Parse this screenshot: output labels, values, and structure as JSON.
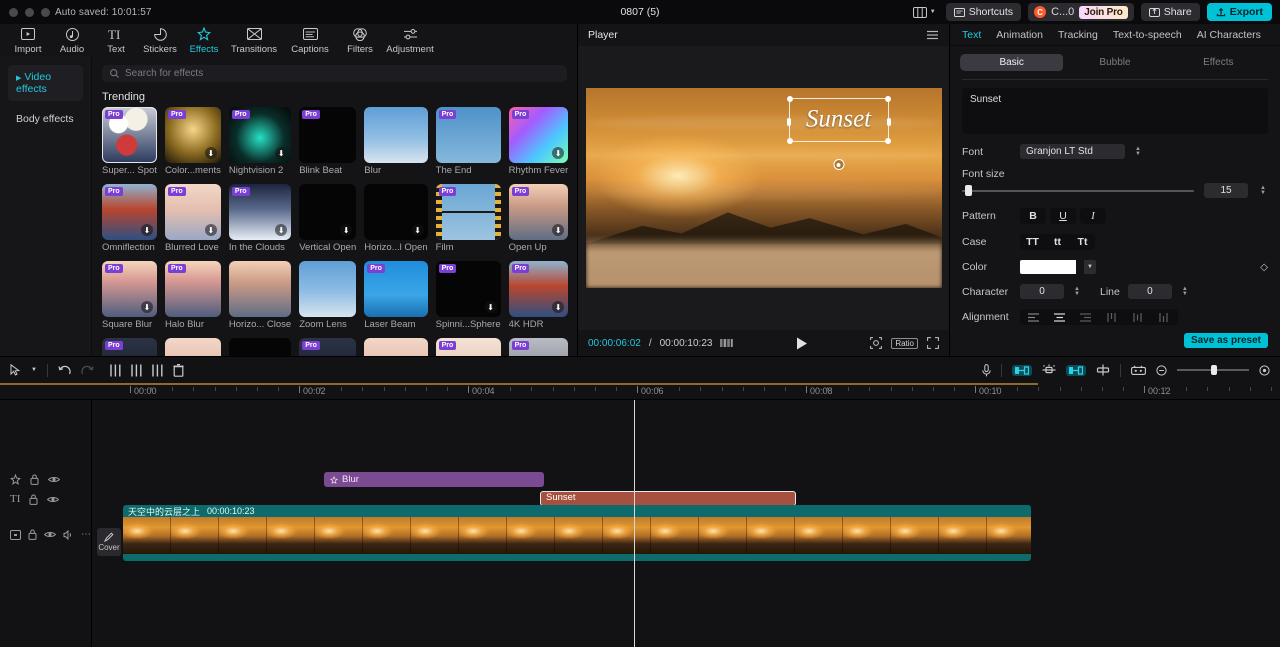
{
  "titlebar": {
    "autosave": "Auto saved: 10:01:57",
    "window_title": "0807 (5)",
    "shortcuts_label": "Shortcuts",
    "account_name": "C...0",
    "account_initial": "C",
    "join_pro_label": "Join Pro",
    "share_label": "Share",
    "export_label": "Export"
  },
  "menubar": {
    "items": [
      {
        "label": "Import",
        "icon": "import-icon"
      },
      {
        "label": "Audio",
        "icon": "audio-icon"
      },
      {
        "label": "Text",
        "icon": "text-icon"
      },
      {
        "label": "Stickers",
        "icon": "stickers-icon"
      },
      {
        "label": "Effects",
        "icon": "effects-icon"
      },
      {
        "label": "Transitions",
        "icon": "transitions-icon"
      },
      {
        "label": "Captions",
        "icon": "captions-icon"
      },
      {
        "label": "Filters",
        "icon": "filters-icon"
      },
      {
        "label": "Adjustment",
        "icon": "adjustment-icon"
      }
    ],
    "active": "Effects"
  },
  "effects_panel": {
    "categories": [
      {
        "label": "Video effects",
        "active": true
      },
      {
        "label": "Body effects",
        "active": false
      }
    ],
    "search_placeholder": "Search for effects",
    "section_title": "Trending",
    "pro_badge": "Pro",
    "items": [
      {
        "name": "Super... Spot",
        "pro": true,
        "download": false,
        "selected": true,
        "style": "bokeh"
      },
      {
        "name": "Color...ments",
        "pro": true,
        "download": true,
        "selected": false,
        "style": "gold"
      },
      {
        "name": "Nightvision 2",
        "pro": true,
        "download": true,
        "selected": false,
        "style": "neon"
      },
      {
        "name": "Blink Beat",
        "pro": true,
        "download": false,
        "selected": false,
        "style": "black"
      },
      {
        "name": "Blur",
        "pro": false,
        "download": false,
        "selected": false,
        "style": "blue"
      },
      {
        "name": "The End",
        "pro": true,
        "download": false,
        "selected": false,
        "style": "film"
      },
      {
        "name": "Rhythm Fever",
        "pro": true,
        "download": true,
        "selected": false,
        "style": "rainbow"
      },
      {
        "name": "Omniflection",
        "pro": true,
        "download": true,
        "selected": false,
        "style": "red"
      },
      {
        "name": "Blurred Love",
        "pro": true,
        "download": true,
        "selected": false,
        "style": "pastel"
      },
      {
        "name": "In the Clouds",
        "pro": true,
        "download": true,
        "selected": false,
        "style": "snow"
      },
      {
        "name": "Vertical Open",
        "pro": false,
        "download": true,
        "selected": false,
        "style": "black"
      },
      {
        "name": "Horizo...l Open",
        "pro": false,
        "download": true,
        "selected": false,
        "style": "black"
      },
      {
        "name": "Film",
        "pro": true,
        "download": false,
        "selected": false,
        "style": "filmstrip"
      },
      {
        "name": "Open Up",
        "pro": true,
        "download": true,
        "selected": false,
        "style": "city"
      },
      {
        "name": "Square Blur",
        "pro": true,
        "download": true,
        "selected": false,
        "style": "citylight"
      },
      {
        "name": "Halo Blur",
        "pro": true,
        "download": false,
        "selected": false,
        "style": "citylight"
      },
      {
        "name": "Horizo... Close",
        "pro": false,
        "download": false,
        "selected": false,
        "style": "city"
      },
      {
        "name": "Zoom Lens",
        "pro": false,
        "download": false,
        "selected": false,
        "style": "blue"
      },
      {
        "name": "Laser Beam",
        "pro": true,
        "download": false,
        "selected": false,
        "style": "laser"
      },
      {
        "name": "Spinni...Sphere",
        "pro": true,
        "download": true,
        "selected": false,
        "style": "black"
      },
      {
        "name": "4K HDR",
        "pro": true,
        "download": true,
        "selected": false,
        "style": "red"
      }
    ],
    "row4_styles": [
      "dark",
      "pastel",
      "black",
      "dark",
      "pastel",
      "hand",
      "grey"
    ]
  },
  "player": {
    "title": "Player",
    "menu_icon": "hamburger-icon",
    "overlay_text": "Sunset",
    "current_time": "00:00:06:02",
    "total_time": "00:00:10:23",
    "separator": "/",
    "play_icon": "play-icon",
    "ratio_label": "Ratio",
    "snapshot_icon": "snapshot-icon",
    "fullscreen_icon": "fullscreen-icon",
    "quality_icon": "quality-icon"
  },
  "properties": {
    "tabs": [
      {
        "label": "Text",
        "active": true
      },
      {
        "label": "Animation",
        "active": false
      },
      {
        "label": "Tracking",
        "active": false
      },
      {
        "label": "Text-to-speech",
        "active": false
      },
      {
        "label": "AI Characters",
        "active": false
      }
    ],
    "segments": [
      {
        "label": "Basic",
        "active": true
      },
      {
        "label": "Bubble",
        "active": false
      },
      {
        "label": "Effects",
        "active": false
      }
    ],
    "text_value": "Sunset",
    "font_label": "Font",
    "font_value": "Granjon LT Std",
    "fontsize_label": "Font size",
    "fontsize_value": "15",
    "pattern_label": "Pattern",
    "pattern_buttons": [
      "B",
      "U",
      "I"
    ],
    "case_label": "Case",
    "case_buttons": [
      "TT",
      "tt",
      "Tt"
    ],
    "color_label": "Color",
    "color_value": "#ffffff",
    "character_label": "Character",
    "character_value": "0",
    "line_label": "Line",
    "line_value": "0",
    "alignment_label": "Alignment",
    "alignment_active": "center",
    "save_preset_label": "Save as preset"
  },
  "timeline": {
    "toolbar": {
      "cursor_icon": "cursor-icon",
      "cursor_dropdown_icon": "chevron-down-icon",
      "undo_icon": "undo-icon",
      "redo_icon": "redo-icon",
      "split_icon": "split-icon",
      "trim_left_icon": "trim-left-icon",
      "trim_right_icon": "trim-right-icon",
      "delete_icon": "delete-icon",
      "mic_icon": "microphone-icon",
      "keyframe_icon": "keyframe-icon",
      "mixer_icon": "mixer-icon",
      "crop_icon": "crop-icon",
      "mask_icon": "mask-icon",
      "freeze_icon": "freeze-icon",
      "zoom_out_icon": "zoom-out-icon",
      "zoom_in_icon": "zoom-in-icon"
    },
    "ruler_labels": [
      "00:00",
      "00:02",
      "00:04",
      "00:06",
      "00:08",
      "00:10",
      "00:12"
    ],
    "playhead_time": "00:06",
    "tracks": [
      {
        "type": "effect",
        "icon": "effects-icon",
        "lock_icon": "lock-icon",
        "eye_icon": "eye-icon"
      },
      {
        "type": "text",
        "icon": "text-icon",
        "lock_icon": "lock-icon",
        "eye_icon": "eye-icon"
      },
      {
        "type": "video",
        "icon": "video-icon",
        "lock_icon": "lock-icon",
        "eye_icon": "eye-icon",
        "audio_icon": "audio-wave-icon",
        "more_icon": "more-icon"
      }
    ],
    "clips": {
      "effect_clip": {
        "label": "Blur",
        "icon": "effects-icon"
      },
      "text_clip": {
        "label": "Sunset"
      },
      "video_clip": {
        "label": "天空中的云层之上",
        "duration": "00:00:10:23"
      }
    },
    "cover_label": "Cover",
    "cover_icon": "pen-icon"
  },
  "colors": {
    "accent": "#22c8dd",
    "export": "#00c2d7",
    "effect_clip": "#7a4a92",
    "text_clip": "#a6503f",
    "video_clip": "#0d6b6b",
    "pro_badge": "#7b3fd4"
  }
}
